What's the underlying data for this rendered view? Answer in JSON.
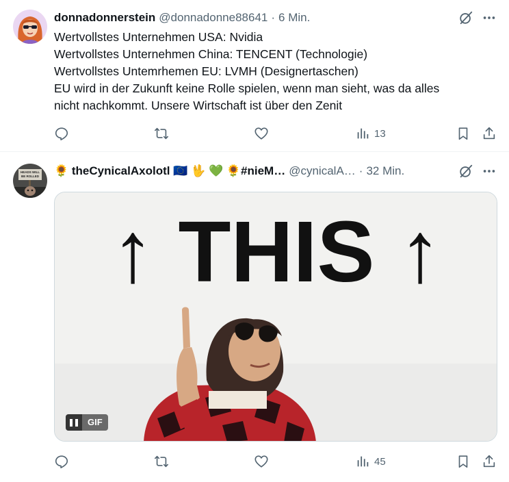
{
  "tweets": [
    {
      "display_name": "donnadonnerstein",
      "handle": "@donnadonne88641",
      "separator": "·",
      "time": "6 Min.",
      "text_lines": [
        "Wertvollstes Unternehmen USA: Nvidia",
        "Wertvollstes Unternehmen China: TENCENT (Technologie)",
        "Wertvollstes Untemrhemen EU: LVMH (Designertaschen)",
        "EU wird in der Zukunft keine Rolle spielen, wenn man sieht, was da alles",
        "nicht nachkommt. Unsere Wirtschaft ist über den Zenit"
      ],
      "views": "13",
      "icons": [
        "grok-icon",
        "more-icon",
        "reply-icon",
        "retweet-icon",
        "like-icon",
        "views-icon",
        "bookmark-icon",
        "share-icon"
      ]
    },
    {
      "display_name": "🌻 theCynicalAxolotl 🇪🇺 🖖 💚 🌻#nieM…",
      "handle": "@cynicalA…",
      "separator": "·",
      "time": "32 Min.",
      "media": {
        "gif_text": "↑ THIS ↑",
        "gif_label": "GIF",
        "avatar_sign": "HEADS WILL BE ROLLED"
      },
      "views": "45",
      "icons": [
        "grok-icon",
        "more-icon",
        "pause-icon",
        "reply-icon",
        "retweet-icon",
        "like-icon",
        "views-icon",
        "bookmark-icon",
        "share-icon"
      ]
    }
  ]
}
